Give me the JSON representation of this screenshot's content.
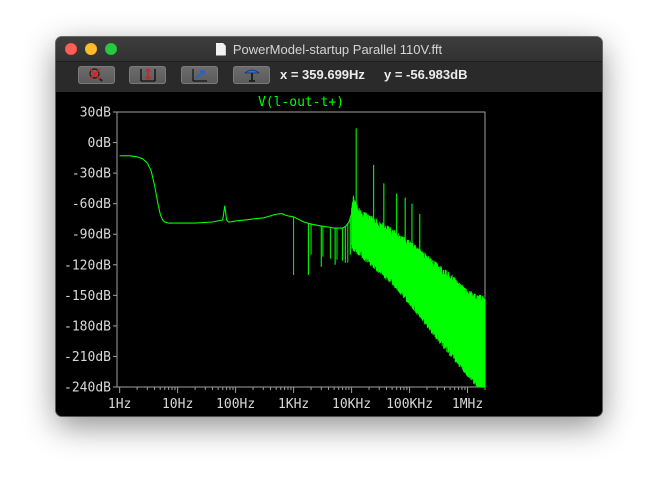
{
  "window": {
    "title": "PowerModel-startup Parallel 110V.fft"
  },
  "toolbar": {
    "buttons": [
      {
        "name": "zoom-cancel-button",
        "icon": "zoom-cancel-icon"
      },
      {
        "name": "autorange-y-button",
        "icon": "autorange-y-icon"
      },
      {
        "name": "zoom-back-button",
        "icon": "zoom-back-icon"
      },
      {
        "name": "probe-button",
        "icon": "probe-icon"
      }
    ],
    "cursor_x": "x = 359.699Hz",
    "cursor_y": "y = -56.983dB"
  },
  "colors": {
    "trace": "#00ff00",
    "axis": "#a0a0a0",
    "background": "#000000"
  },
  "chart_data": {
    "type": "line",
    "title": "V(l-out-t+)",
    "x_scale": "log",
    "xlim": [
      0.9,
      2000000
    ],
    "ylim": [
      -240,
      30
    ],
    "y_ticks": [
      "30dB",
      "0dB",
      "-30dB",
      "-60dB",
      "-90dB",
      "-120dB",
      "-150dB",
      "-180dB",
      "-210dB",
      "-240dB"
    ],
    "y_tick_values": [
      30,
      0,
      -30,
      -60,
      -90,
      -120,
      -150,
      -180,
      -210,
      -240
    ],
    "x_ticks": [
      "1Hz",
      "10Hz",
      "100Hz",
      "1KHz",
      "10KHz",
      "100KHz",
      "1MHz"
    ],
    "x_tick_values": [
      1,
      10,
      100,
      1000,
      10000,
      100000,
      1000000
    ],
    "grid": false,
    "series": [
      {
        "name": "V(l-out-t+)",
        "x": [
          1,
          1.5,
          2,
          2.5,
          3,
          3.5,
          4,
          4.5,
          5,
          5.5,
          6,
          7,
          10,
          20,
          40,
          60,
          65,
          70,
          75,
          80,
          100,
          150,
          200,
          300,
          400,
          450,
          500,
          550,
          600,
          650,
          700,
          800,
          900,
          1000,
          1500,
          2000,
          3000,
          4000,
          5000,
          6000,
          7000,
          8000,
          9000,
          10000,
          11000,
          12000,
          13000,
          14000,
          15000,
          20000,
          30000,
          50000,
          100000,
          200000,
          300000,
          500000,
          700000,
          1000000,
          1500000,
          2000000
        ],
        "y": [
          -13,
          -13,
          -14,
          -16,
          -20,
          -28,
          -42,
          -58,
          -70,
          -76,
          -78,
          -79,
          -79,
          -79,
          -78,
          -76,
          -62,
          -76,
          -78,
          -78,
          -77,
          -76,
          -75,
          -74,
          -72,
          -71,
          -70.5,
          -70,
          -70,
          -70,
          -71,
          -72,
          -72.5,
          -73,
          -78,
          -80,
          -82,
          -83,
          -84,
          -84,
          -84,
          -82,
          -78,
          -70,
          -62,
          -70,
          -74,
          -76,
          -78,
          -82,
          -88,
          -96,
          -108,
          -122,
          -130,
          -140,
          -148,
          -156,
          -160,
          -164
        ],
        "spikes": [
          {
            "x": 1800,
            "y": -130
          },
          {
            "x": 3000,
            "y": -122
          },
          {
            "x": 5200,
            "y": -120
          },
          {
            "x": 7800,
            "y": -118
          },
          {
            "x": 9500,
            "y": -110
          },
          {
            "x": 12000,
            "y": 14
          },
          {
            "x": 24000,
            "y": -22
          },
          {
            "x": 36000,
            "y": -40
          },
          {
            "x": 60000,
            "y": -50
          },
          {
            "x": 84000,
            "y": -54
          },
          {
            "x": 110000,
            "y": -60
          },
          {
            "x": 150000,
            "y": -70
          }
        ],
        "notches": [
          {
            "x": 1000,
            "y": -130
          },
          {
            "x": 2000,
            "y": -110
          },
          {
            "x": 3200,
            "y": -112
          },
          {
            "x": 4300,
            "y": -114
          },
          {
            "x": 5600,
            "y": -115
          },
          {
            "x": 7000,
            "y": -116
          },
          {
            "x": 8600,
            "y": -118
          }
        ],
        "band_floor": [
          {
            "x": 10000,
            "y": -95
          },
          {
            "x": 20000,
            "y": -110
          },
          {
            "x": 50000,
            "y": -130
          },
          {
            "x": 100000,
            "y": -150
          },
          {
            "x": 300000,
            "y": -185
          },
          {
            "x": 700000,
            "y": -210
          },
          {
            "x": 1000000,
            "y": -220
          },
          {
            "x": 2000000,
            "y": -240
          }
        ]
      }
    ]
  }
}
